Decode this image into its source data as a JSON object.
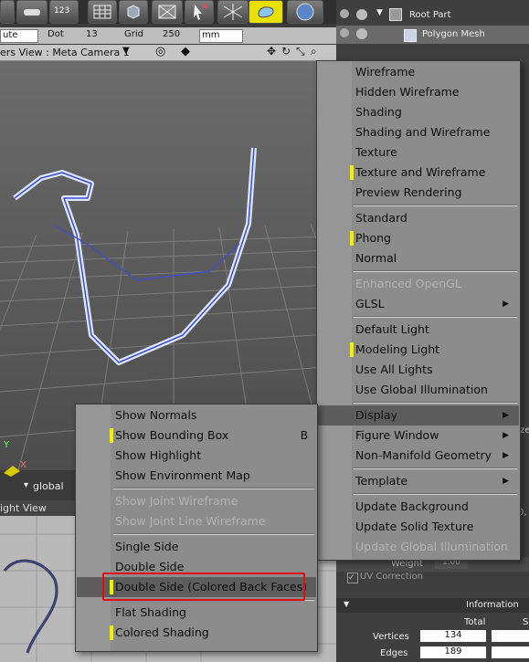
{
  "toolbar": {
    "counter_label": "123",
    "tools": [
      "car-icon",
      "grid-icon",
      "cube-icon",
      "checker-icon",
      "cursor-icon",
      "wire-icon",
      "paint-icon",
      "sphere-icon"
    ]
  },
  "fieldbar": {
    "snap_value": "ute",
    "dot_label": "Dot",
    "dot_value": "13",
    "grid_label": "Grid",
    "grid_value": "250",
    "unit_value": "mm"
  },
  "view": {
    "title": "ers View : Meta Camera 1",
    "global_label": "global",
    "axis_y": "Y",
    "axis_x": "X"
  },
  "view2": {
    "title": "ight View"
  },
  "tree": {
    "root": "Root Part",
    "child": "Polygon Mesh"
  },
  "main_menu": {
    "items": [
      {
        "label": "Wireframe",
        "enabled": true,
        "checked": false
      },
      {
        "label": "Hidden Wireframe",
        "enabled": true,
        "checked": false
      },
      {
        "label": "Shading",
        "enabled": true,
        "checked": false
      },
      {
        "label": "Shading and Wireframe",
        "enabled": true,
        "checked": false
      },
      {
        "label": "Texture",
        "enabled": true,
        "checked": false
      },
      {
        "label": "Texture and Wireframe",
        "enabled": true,
        "checked": true
      },
      {
        "label": "Preview Rendering",
        "enabled": true,
        "checked": false
      },
      {
        "label": "Standard",
        "enabled": true,
        "checked": false
      },
      {
        "label": "Phong",
        "enabled": true,
        "checked": true
      },
      {
        "label": "Normal",
        "enabled": true,
        "checked": false
      },
      {
        "label": "Enhanced OpenGL",
        "enabled": false,
        "checked": false
      },
      {
        "label": "GLSL",
        "enabled": true,
        "checked": false
      },
      {
        "label": "Default Light",
        "enabled": true,
        "checked": false
      },
      {
        "label": "Modeling Light",
        "enabled": true,
        "checked": true
      },
      {
        "label": "Use All Lights",
        "enabled": true,
        "checked": false
      },
      {
        "label": "Use Global Illumination",
        "enabled": true,
        "checked": false
      },
      {
        "label": "Display",
        "enabled": true,
        "checked": false
      },
      {
        "label": "Figure Window",
        "enabled": true,
        "checked": false
      },
      {
        "label": "Non-Manifold Geometry",
        "enabled": true,
        "checked": false
      },
      {
        "label": "Template",
        "enabled": true,
        "checked": false
      },
      {
        "label": "Update Background",
        "enabled": true,
        "checked": false
      },
      {
        "label": "Update Solid Texture",
        "enabled": true,
        "checked": false
      },
      {
        "label": "Update Global Illumination",
        "enabled": false,
        "checked": false
      }
    ]
  },
  "sub_menu": {
    "items": [
      {
        "label": "Show Normals",
        "enabled": true,
        "checked": false
      },
      {
        "label": "Show Bounding Box",
        "enabled": true,
        "checked": true,
        "shortcut": "B"
      },
      {
        "label": "Show Highlight",
        "enabled": true,
        "checked": false
      },
      {
        "label": "Show Environment Map",
        "enabled": true,
        "checked": false
      },
      {
        "label": "Show Joint Wireframe",
        "enabled": false,
        "checked": false
      },
      {
        "label": "Show Joint Line Wireframe",
        "enabled": false,
        "checked": false
      },
      {
        "label": "Single Side",
        "enabled": true,
        "checked": false
      },
      {
        "label": "Double Side",
        "enabled": true,
        "checked": false
      },
      {
        "label": "Double Side (Colored Back Faces)",
        "enabled": true,
        "checked": true
      },
      {
        "label": "Flat Shading",
        "enabled": true,
        "checked": false
      },
      {
        "label": "Colored Shading",
        "enabled": true,
        "checked": true
      }
    ]
  },
  "panel": {
    "weight_label": "Weight",
    "weight_value": "1.00",
    "uv_correction": "UV Correction",
    "information": "Information",
    "total": "Total",
    "s_col": "S",
    "vertices_label": "Vertices",
    "vertices_total": "134",
    "edges_label": "Edges",
    "edges_total": "189",
    "partial_right_a": "ze",
    "partial_right_b": "0,"
  },
  "colors": {
    "checked_mark": "#f2f000",
    "highlight_box": "#e01010",
    "wire": "#3a4fd6"
  }
}
